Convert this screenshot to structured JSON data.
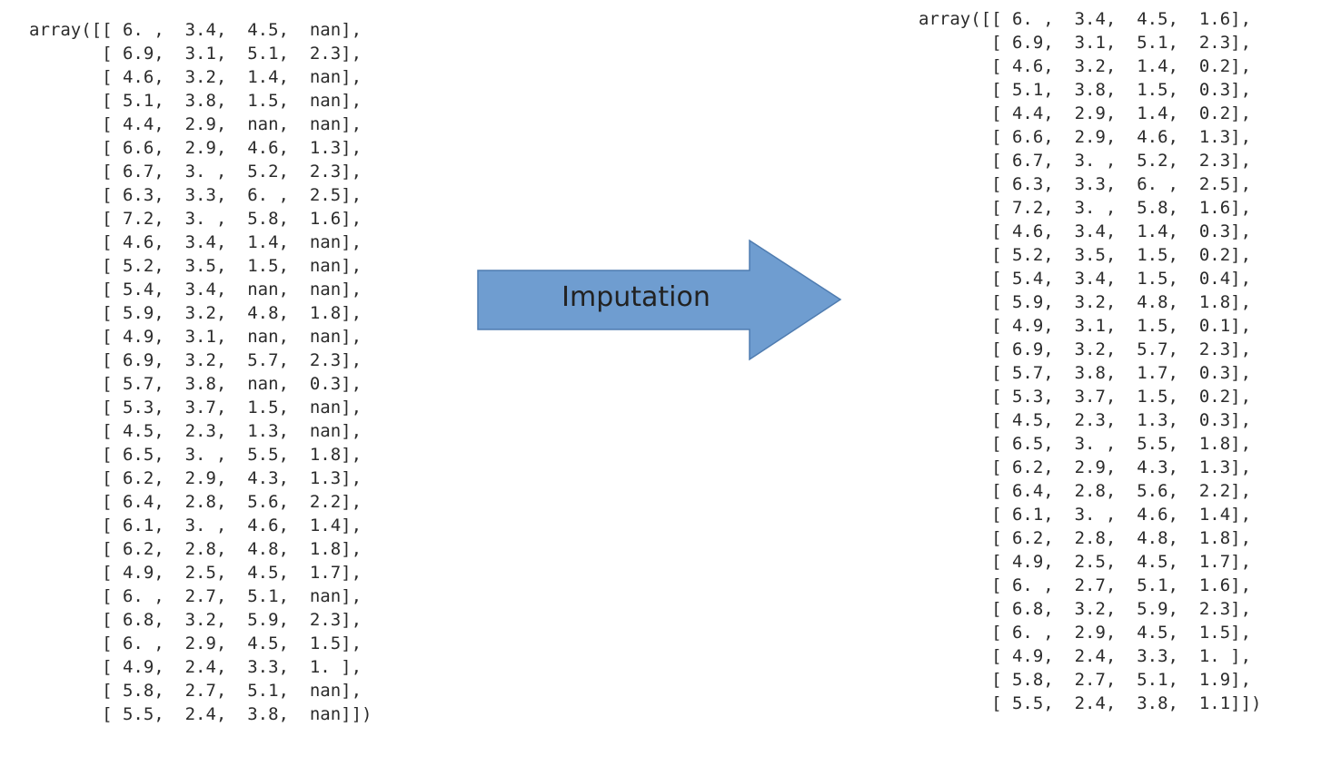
{
  "before": {
    "lines": [
      "array([[ 6. ,  3.4,  4.5,  nan],",
      "       [ 6.9,  3.1,  5.1,  2.3],",
      "       [ 4.6,  3.2,  1.4,  nan],",
      "       [ 5.1,  3.8,  1.5,  nan],",
      "       [ 4.4,  2.9,  nan,  nan],",
      "       [ 6.6,  2.9,  4.6,  1.3],",
      "       [ 6.7,  3. ,  5.2,  2.3],",
      "       [ 6.3,  3.3,  6. ,  2.5],",
      "       [ 7.2,  3. ,  5.8,  1.6],",
      "       [ 4.6,  3.4,  1.4,  nan],",
      "       [ 5.2,  3.5,  1.5,  nan],",
      "       [ 5.4,  3.4,  nan,  nan],",
      "       [ 5.9,  3.2,  4.8,  1.8],",
      "       [ 4.9,  3.1,  nan,  nan],",
      "       [ 6.9,  3.2,  5.7,  2.3],",
      "       [ 5.7,  3.8,  nan,  0.3],",
      "       [ 5.3,  3.7,  1.5,  nan],",
      "       [ 4.5,  2.3,  1.3,  nan],",
      "       [ 6.5,  3. ,  5.5,  1.8],",
      "       [ 6.2,  2.9,  4.3,  1.3],",
      "       [ 6.4,  2.8,  5.6,  2.2],",
      "       [ 6.1,  3. ,  4.6,  1.4],",
      "       [ 6.2,  2.8,  4.8,  1.8],",
      "       [ 4.9,  2.5,  4.5,  1.7],",
      "       [ 6. ,  2.7,  5.1,  nan],",
      "       [ 6.8,  3.2,  5.9,  2.3],",
      "       [ 6. ,  2.9,  4.5,  1.5],",
      "       [ 4.9,  2.4,  3.3,  1. ],",
      "       [ 5.8,  2.7,  5.1,  nan],",
      "       [ 5.5,  2.4,  3.8,  nan]])"
    ]
  },
  "arrow": {
    "label": "Imputation",
    "fill": "#6f9dd0",
    "stroke": "#4f7cb0"
  },
  "after": {
    "lines": [
      "array([[ 6. ,  3.4,  4.5,  1.6],",
      "       [ 6.9,  3.1,  5.1,  2.3],",
      "       [ 4.6,  3.2,  1.4,  0.2],",
      "       [ 5.1,  3.8,  1.5,  0.3],",
      "       [ 4.4,  2.9,  1.4,  0.2],",
      "       [ 6.6,  2.9,  4.6,  1.3],",
      "       [ 6.7,  3. ,  5.2,  2.3],",
      "       [ 6.3,  3.3,  6. ,  2.5],",
      "       [ 7.2,  3. ,  5.8,  1.6],",
      "       [ 4.6,  3.4,  1.4,  0.3],",
      "       [ 5.2,  3.5,  1.5,  0.2],",
      "       [ 5.4,  3.4,  1.5,  0.4],",
      "       [ 5.9,  3.2,  4.8,  1.8],",
      "       [ 4.9,  3.1,  1.5,  0.1],",
      "       [ 6.9,  3.2,  5.7,  2.3],",
      "       [ 5.7,  3.8,  1.7,  0.3],",
      "       [ 5.3,  3.7,  1.5,  0.2],",
      "       [ 4.5,  2.3,  1.3,  0.3],",
      "       [ 6.5,  3. ,  5.5,  1.8],",
      "       [ 6.2,  2.9,  4.3,  1.3],",
      "       [ 6.4,  2.8,  5.6,  2.2],",
      "       [ 6.1,  3. ,  4.6,  1.4],",
      "       [ 6.2,  2.8,  4.8,  1.8],",
      "       [ 4.9,  2.5,  4.5,  1.7],",
      "       [ 6. ,  2.7,  5.1,  1.6],",
      "       [ 6.8,  3.2,  5.9,  2.3],",
      "       [ 6. ,  2.9,  4.5,  1.5],",
      "       [ 4.9,  2.4,  3.3,  1. ],",
      "       [ 5.8,  2.7,  5.1,  1.9],",
      "       [ 5.5,  2.4,  3.8,  1.1]])"
    ]
  }
}
